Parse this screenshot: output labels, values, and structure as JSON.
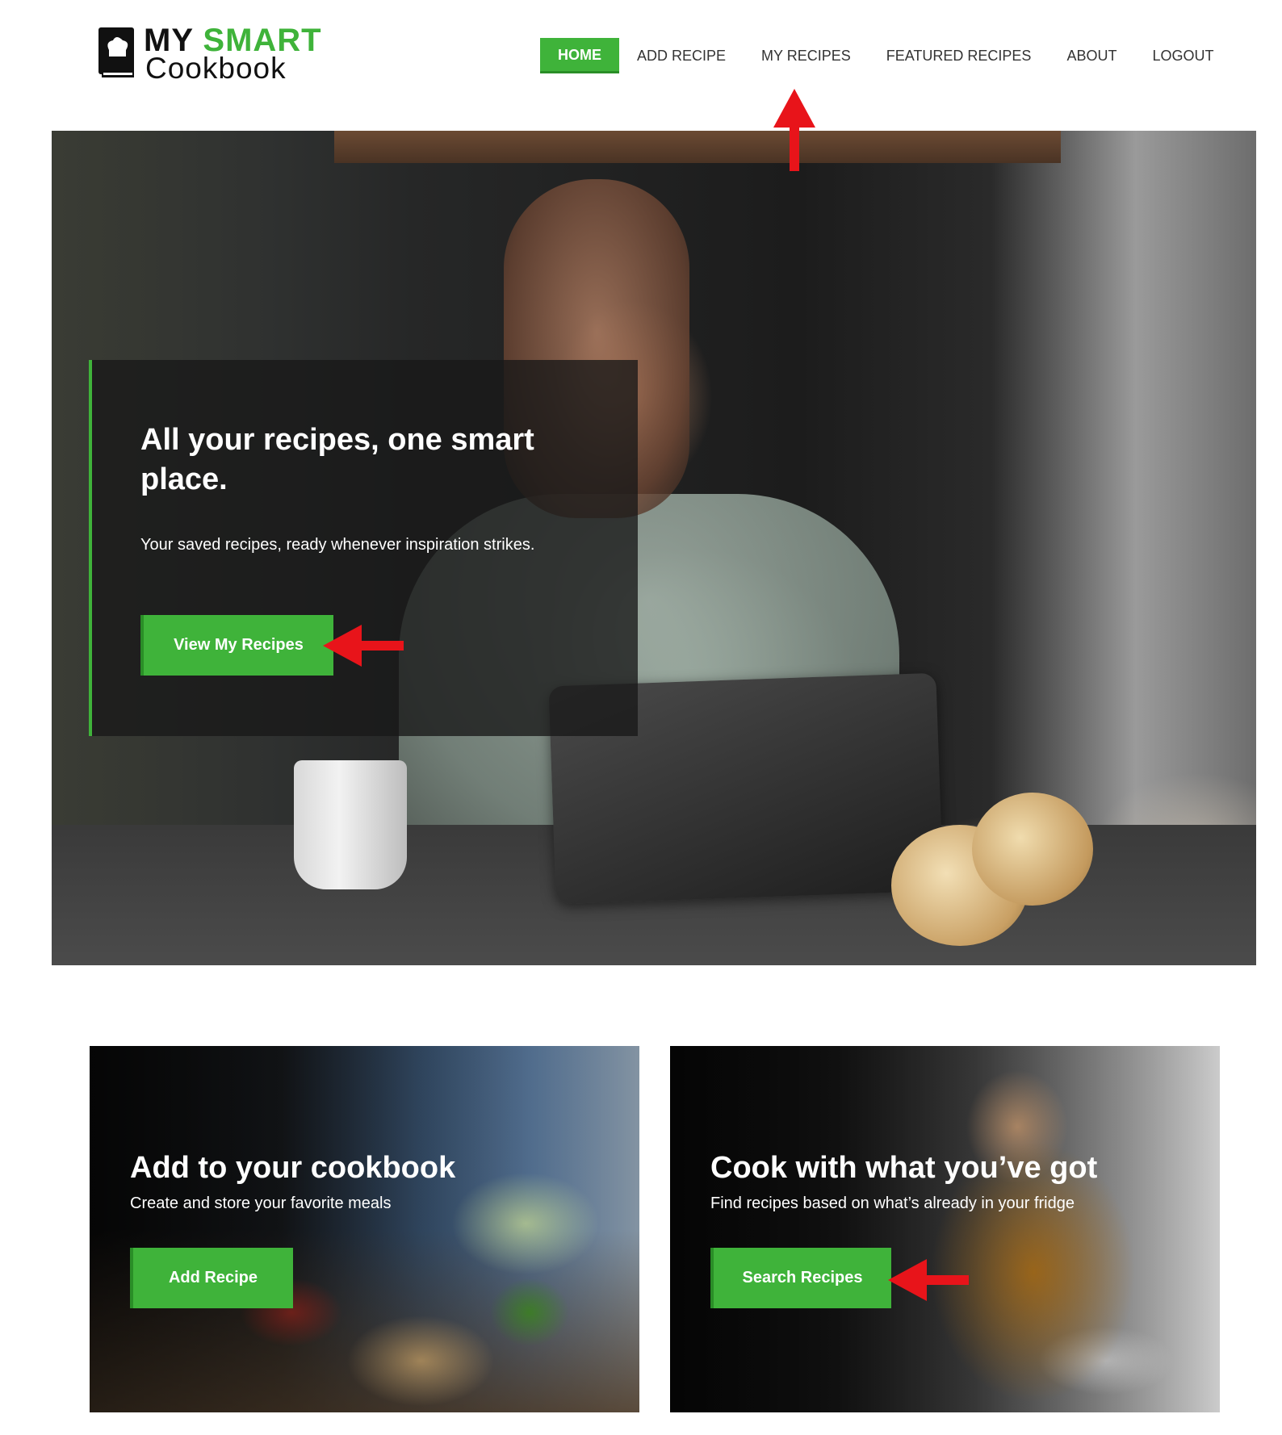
{
  "brand": {
    "line1_part1": "MY",
    "line1_part2": "SMART",
    "line2": "Cookbook",
    "accent_color": "#3fb33a",
    "icon": "chef-book-icon"
  },
  "nav": {
    "items": [
      {
        "label": "HOME",
        "active": true
      },
      {
        "label": "ADD RECIPE",
        "active": false
      },
      {
        "label": "MY RECIPES",
        "active": false
      },
      {
        "label": "FEATURED RECIPES",
        "active": false
      },
      {
        "label": "ABOUT",
        "active": false
      },
      {
        "label": "LOGOUT",
        "active": false
      }
    ]
  },
  "hero": {
    "title": "All your recipes, one smart place.",
    "subtitle": "Your saved recipes, ready whenever inspiration strikes.",
    "button_label": "View My Recipes"
  },
  "cards": [
    {
      "title": "Add to your cookbook",
      "subtitle": "Create and store your favorite meals",
      "button_label": "Add Recipe"
    },
    {
      "title": "Cook with what you’ve got",
      "subtitle": "Find recipes based on what’s already in your fridge",
      "button_label": "Search Recipes"
    }
  ],
  "annotations": {
    "arrow_color": "#e8141a",
    "arrows": [
      "arrow-up-icon",
      "arrow-left-icon",
      "arrow-left-icon"
    ]
  }
}
